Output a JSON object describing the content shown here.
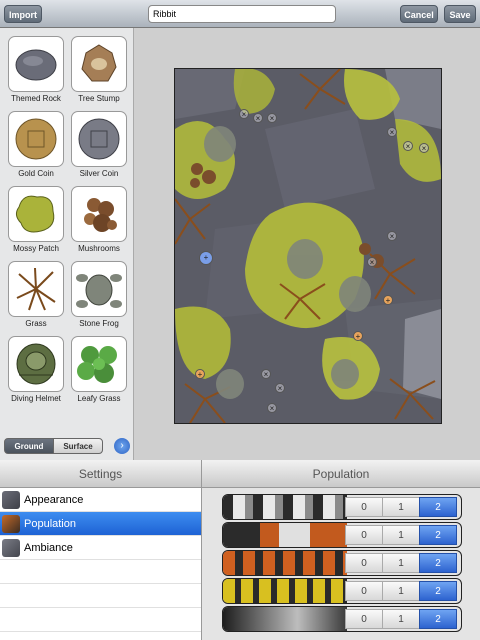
{
  "toolbar": {
    "import_label": "Import",
    "title_value": "Ribbit",
    "cancel_label": "Cancel",
    "save_label": "Save"
  },
  "palette": {
    "items": [
      {
        "label": "Themed Rock",
        "icon": "rock-icon"
      },
      {
        "label": "Tree Stump",
        "icon": "tree-stump-icon"
      },
      {
        "label": "Gold Coin",
        "icon": "gold-coin-icon"
      },
      {
        "label": "Silver Coin",
        "icon": "silver-coin-icon"
      },
      {
        "label": "Mossy Patch",
        "icon": "mossy-patch-icon"
      },
      {
        "label": "Mushrooms",
        "icon": "mushrooms-icon"
      },
      {
        "label": "Grass",
        "icon": "grass-icon"
      },
      {
        "label": "Stone Frog",
        "icon": "stone-frog-icon"
      },
      {
        "label": "Diving Helmet",
        "icon": "diving-helmet-icon"
      },
      {
        "label": "Leafy Grass",
        "icon": "leafy-grass-icon"
      }
    ],
    "segments": {
      "ground": "Ground",
      "surface": "Surface",
      "selected": "Ground"
    }
  },
  "settings": {
    "header": "Settings",
    "items": [
      {
        "label": "Appearance",
        "selected": false
      },
      {
        "label": "Population",
        "selected": true
      },
      {
        "label": "Ambiance",
        "selected": false
      }
    ]
  },
  "population": {
    "header": "Population",
    "options": [
      "0",
      "1",
      "2"
    ],
    "rows": [
      {
        "selected": "2"
      },
      {
        "selected": "2"
      },
      {
        "selected": "2"
      },
      {
        "selected": "2"
      },
      {
        "selected": "2"
      }
    ]
  },
  "colors": {
    "accent_blue": "#2d63cf",
    "moss": "#b5be3a",
    "rock": "#5b5c66"
  }
}
